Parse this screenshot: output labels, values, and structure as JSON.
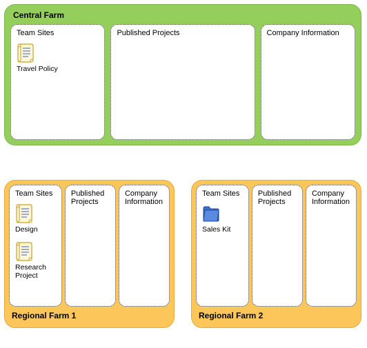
{
  "central": {
    "title": "Central Farm",
    "boxes": {
      "team_sites": "Team Sites",
      "published_projects": "Published Projects",
      "company_info": "Company Information"
    },
    "items": {
      "travel_policy": "Travel Policy"
    }
  },
  "regional1": {
    "title": "Regional Farm 1",
    "boxes": {
      "team_sites": "Team Sites",
      "published_projects": "Published Projects",
      "company_info": "Company Information"
    },
    "items": {
      "design": "Design",
      "research_project": "Research Project"
    }
  },
  "regional2": {
    "title": "Regional Farm 2",
    "boxes": {
      "team_sites": "Team Sites",
      "published_projects": "Published Projects",
      "company_info": "Company Information"
    },
    "items": {
      "sales_kit": "Sales Kit"
    }
  }
}
